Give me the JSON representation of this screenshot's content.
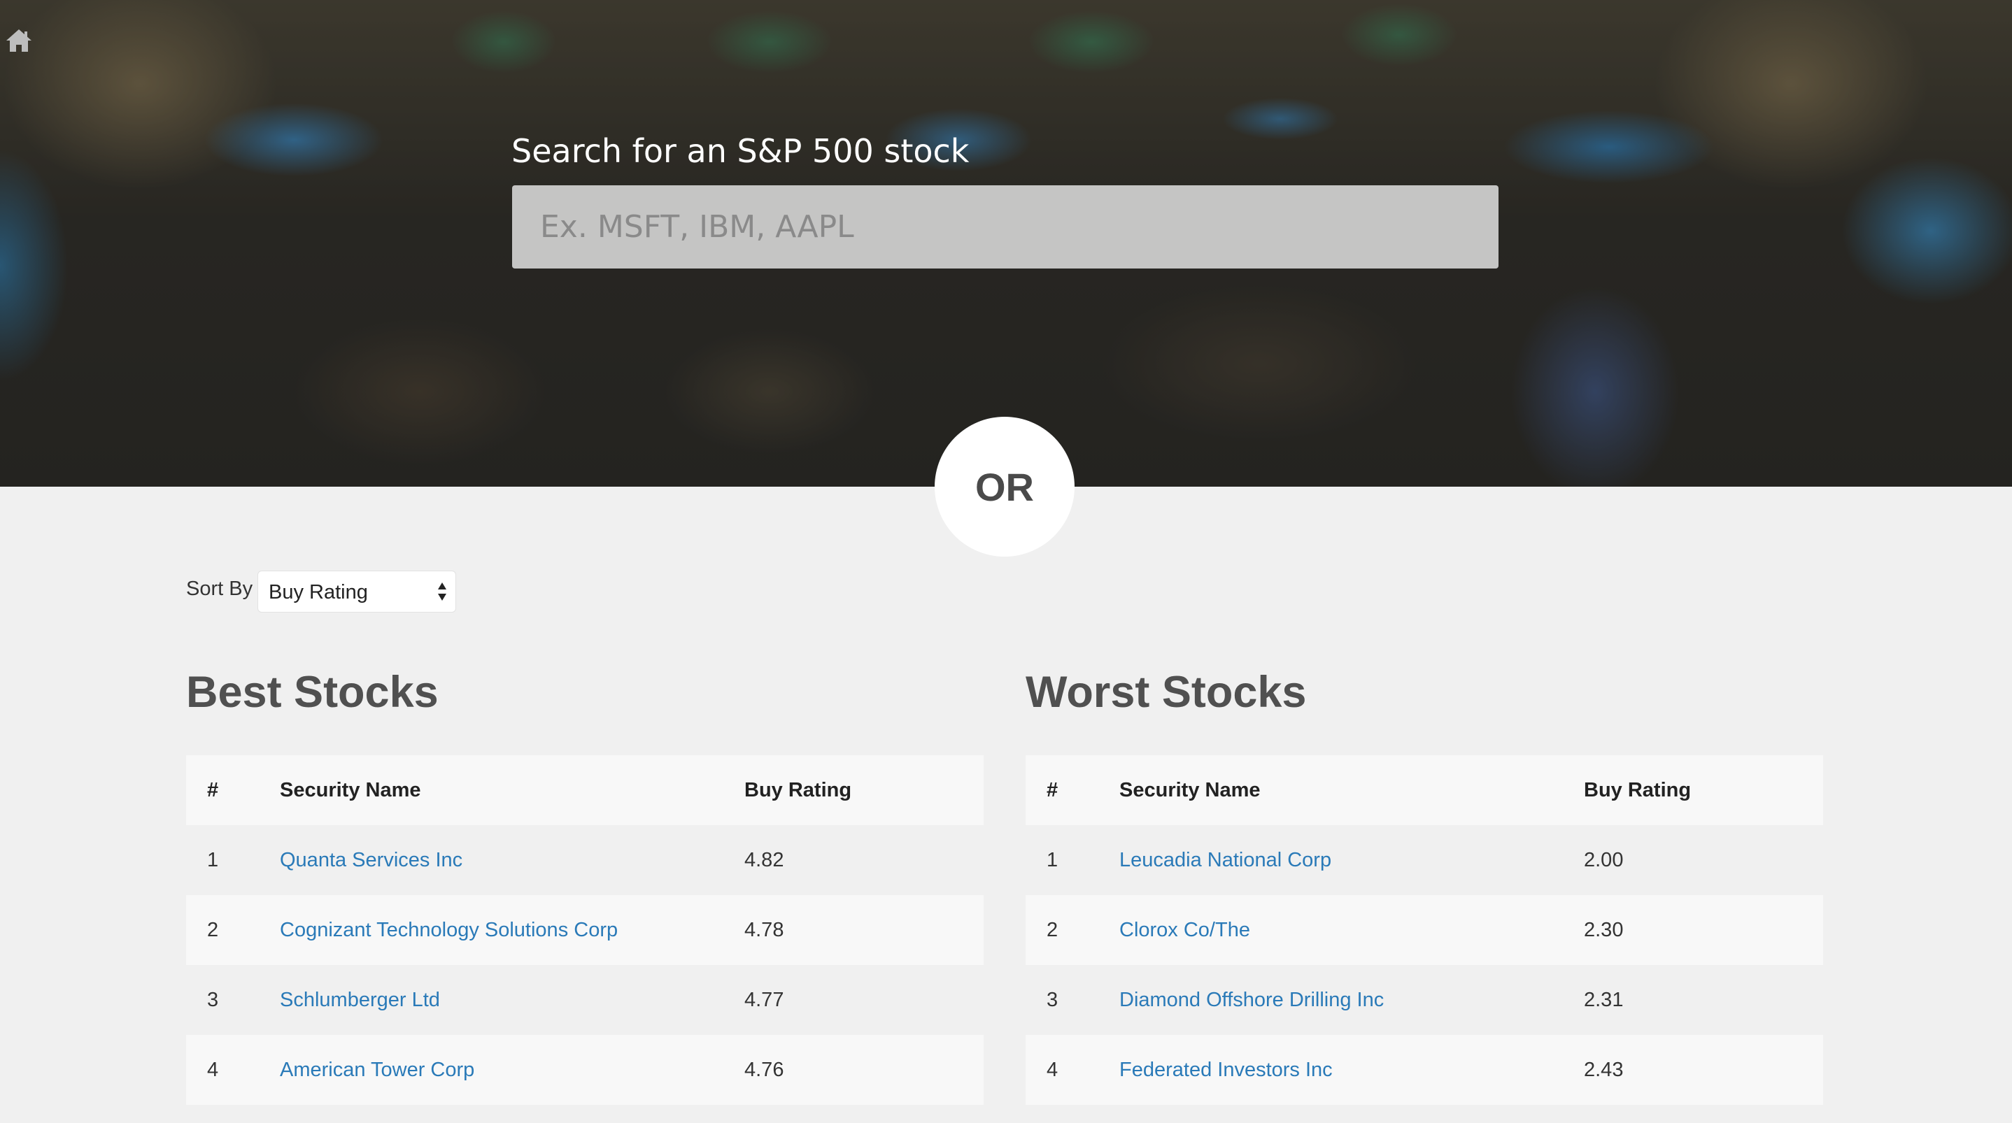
{
  "search": {
    "label": "Search for an S&P 500 stock",
    "placeholder": "Ex. MSFT, IBM, AAPL",
    "value": ""
  },
  "divider": {
    "text": "OR"
  },
  "sort": {
    "label": "Sort By",
    "selected": "Buy Rating"
  },
  "columns": {
    "rank": "#",
    "name": "Security Name",
    "rating": "Buy Rating"
  },
  "best": {
    "title": "Best Stocks",
    "rows": [
      {
        "rank": "1",
        "name": "Quanta Services Inc",
        "rating": "4.82"
      },
      {
        "rank": "2",
        "name": "Cognizant Technology Solutions Corp",
        "rating": "4.78"
      },
      {
        "rank": "3",
        "name": "Schlumberger Ltd",
        "rating": "4.77"
      },
      {
        "rank": "4",
        "name": "American Tower Corp",
        "rating": "4.76"
      }
    ]
  },
  "worst": {
    "title": "Worst Stocks",
    "rows": [
      {
        "rank": "1",
        "name": "Leucadia National Corp",
        "rating": "2.00"
      },
      {
        "rank": "2",
        "name": "Clorox Co/The",
        "rating": "2.30"
      },
      {
        "rank": "3",
        "name": "Diamond Offshore Drilling Inc",
        "rating": "2.31"
      },
      {
        "rank": "4",
        "name": "Federated Investors Inc",
        "rating": "2.43"
      }
    ]
  },
  "colors": {
    "link": "#2a7ab8",
    "heading": "#505050",
    "page_bg": "#f0f0f0"
  },
  "icons": {
    "home": "home-icon",
    "sort": "sort-arrows-icon"
  }
}
